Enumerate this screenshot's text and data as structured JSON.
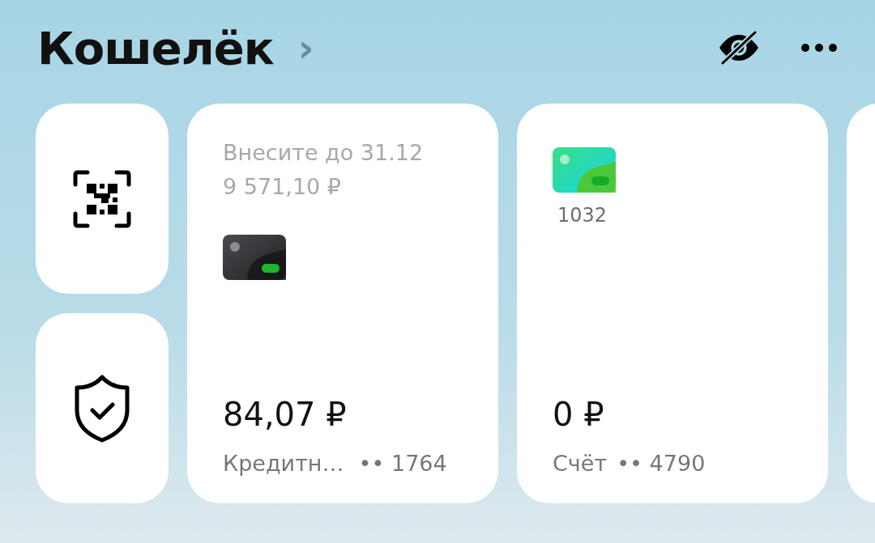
{
  "header": {
    "title": "Кошелёк",
    "chevron": "›"
  },
  "quick_actions": [
    {
      "kind": "qr"
    },
    {
      "kind": "shield"
    }
  ],
  "cards": [
    {
      "kind": "credit",
      "notice": "Внесите до 31.12",
      "due_amount": "9 571,10 ₽",
      "balance": "84,07 ₽",
      "name": "Кредитн…",
      "number": "•• 1764"
    },
    {
      "kind": "debit",
      "card_number": "1032",
      "balance": "0 ₽",
      "name": "Счёт",
      "number": "•• 4790"
    },
    {
      "kind": "partial"
    }
  ]
}
